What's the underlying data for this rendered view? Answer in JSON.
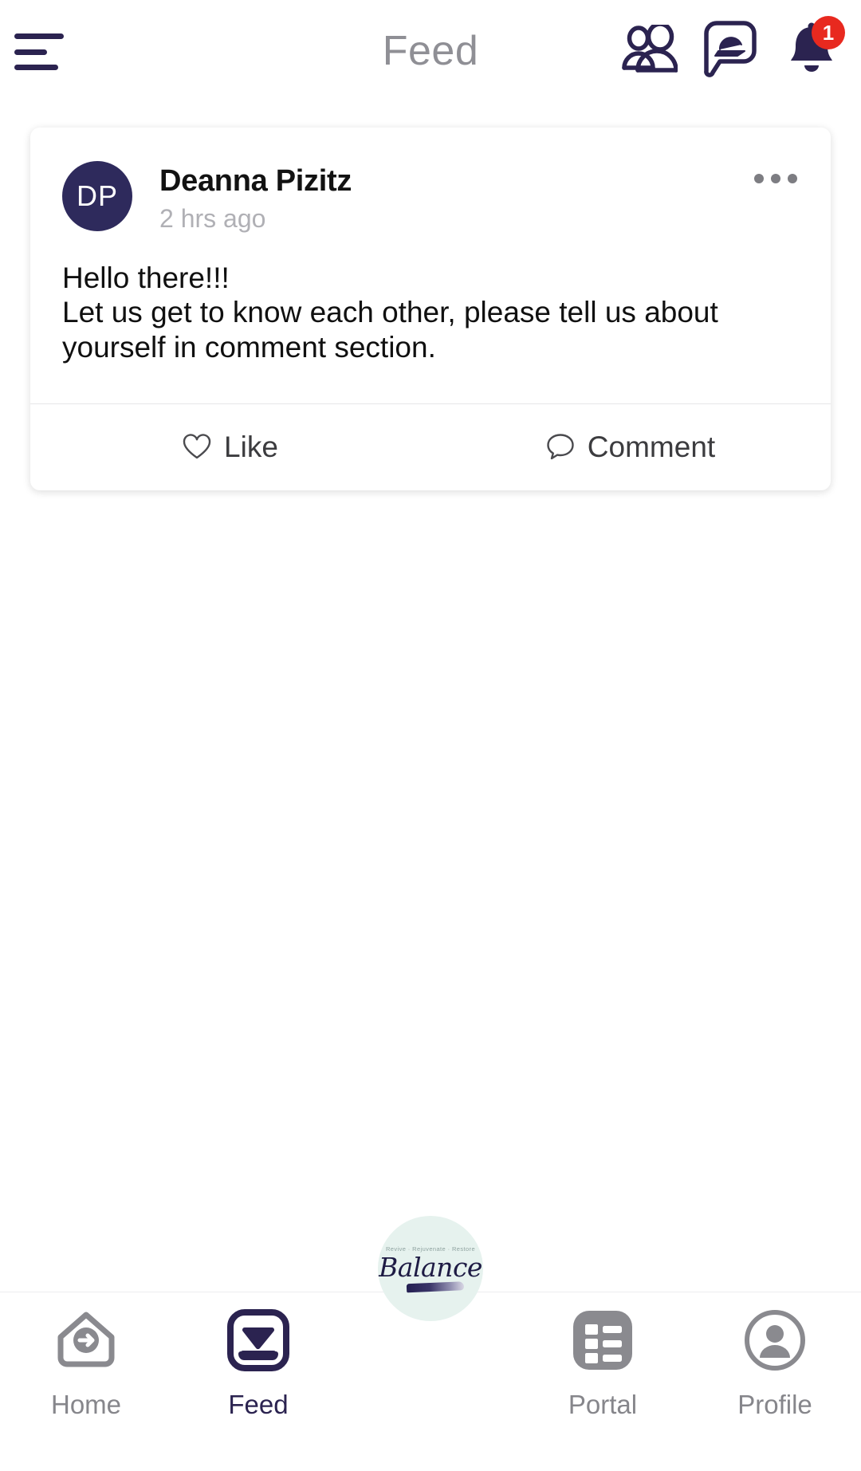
{
  "header": {
    "title": "Feed",
    "menu_icon": "hamburger-menu-icon",
    "icons": [
      {
        "name": "people-icon",
        "label": "Members"
      },
      {
        "name": "chat-cap-icon",
        "label": "Messages"
      },
      {
        "name": "bell-icon",
        "label": "Notifications",
        "badge": "1"
      }
    ]
  },
  "post": {
    "avatar_initials": "DP",
    "author": "Deanna Pizitz",
    "timestamp": "2 hrs ago",
    "body": "Hello there!!!\nLet us get to know each other, please tell us about yourself in comment section.",
    "menu_icon": "more-options-icon",
    "actions": {
      "like_label": "Like",
      "like_icon": "heart-outline-icon",
      "comment_label": "Comment",
      "comment_icon": "speech-bubble-icon"
    }
  },
  "logo": {
    "tagline": "Revive · Rejuvenate · Restore",
    "word": "Balance"
  },
  "bottom_nav": {
    "items": [
      {
        "label": "Home",
        "icon": "home-arrow-icon",
        "active": false
      },
      {
        "label": "Feed",
        "icon": "feed-inbox-icon",
        "active": true
      },
      {
        "label": "Portal",
        "icon": "list-grid-icon",
        "active": false
      },
      {
        "label": "Profile",
        "icon": "person-circle-icon",
        "active": false
      }
    ]
  },
  "colors": {
    "brand_navy": "#2b2350",
    "avatar_navy": "#2e2a5c",
    "badge_red": "#e8291f",
    "inactive_gray": "#86868b",
    "logo_mint": "#e6f2ee"
  }
}
